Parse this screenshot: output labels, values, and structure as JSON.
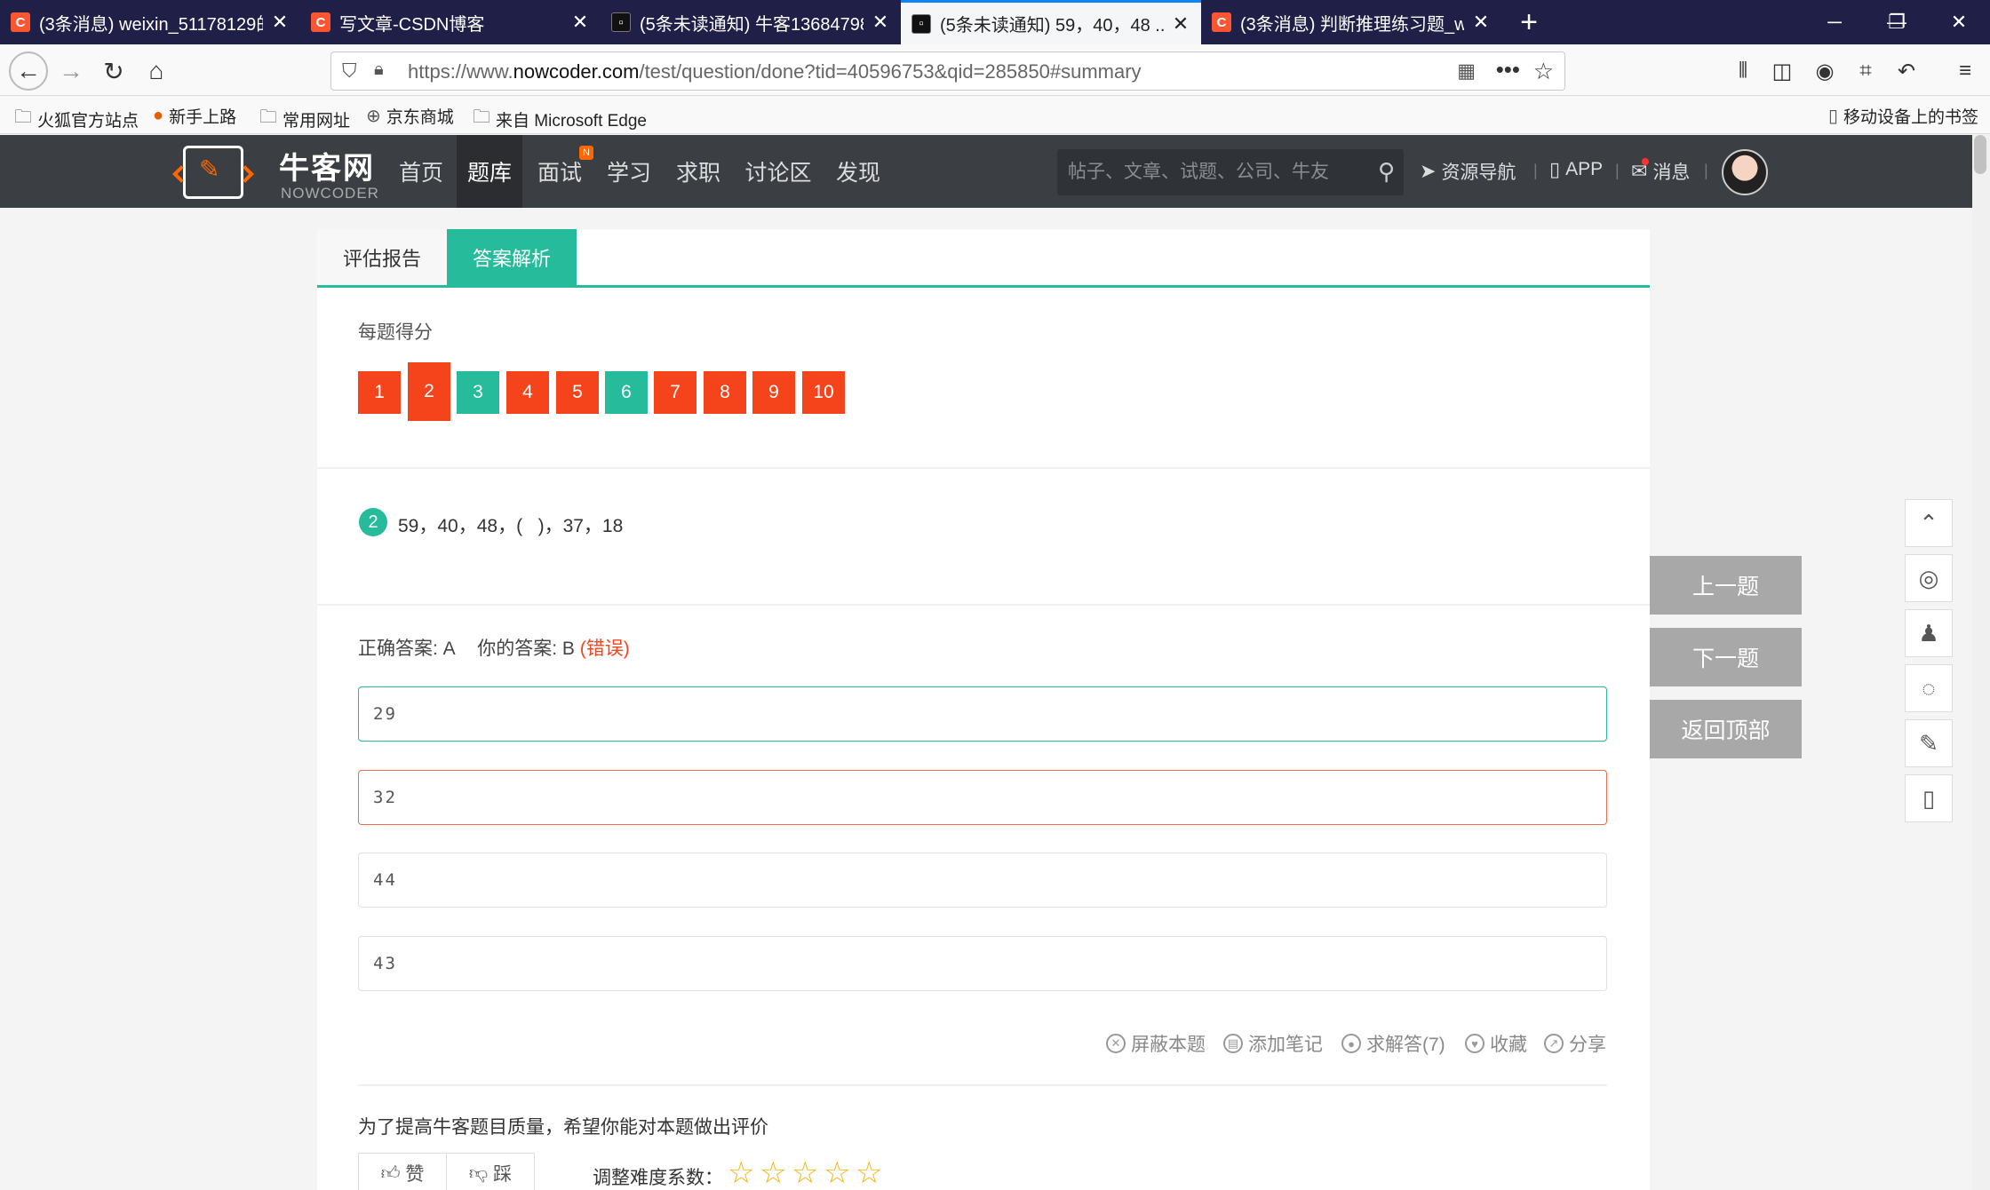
{
  "browser": {
    "tabs": [
      {
        "title": "(3条消息) weixin_51178129的",
        "icon": "csdn-icon"
      },
      {
        "title": "写文章-CSDN博客",
        "icon": "csdn-icon"
      },
      {
        "title": "(5条未读通知) 牛客136847985",
        "icon": "nowcoder-icon"
      },
      {
        "title": "(5条未读通知) 59，40，48 ..._",
        "icon": "nowcoder-icon"
      },
      {
        "title": "(3条消息) 判断推理练习题_wei",
        "icon": "csdn-icon"
      }
    ],
    "url_prefix": "https://www.",
    "url_domain": "nowcoder.com",
    "url_path": "/test/question/done?tid=40596753&qid=285850#summary",
    "bookmarks": [
      "火狐官方站点",
      "新手上路",
      "常用网址",
      "京东商城",
      "来自 Microsoft Edge"
    ],
    "mobile_bookmarks": "移动设备上的书签"
  },
  "site": {
    "logo_cn": "牛客网",
    "logo_en": "NOWCODER",
    "nav": [
      "首页",
      "题库",
      "面试",
      "学习",
      "求职",
      "讨论区",
      "发现"
    ],
    "nav_badge": "N",
    "search_placeholder": "帖子、文章、试题、公司、牛友",
    "resource_nav": "资源导航",
    "app": "APP",
    "messages": "消息"
  },
  "card": {
    "tabs": [
      "评估报告",
      "答案解析"
    ],
    "score_label": "每题得分",
    "questions": [
      {
        "num": "1",
        "status": "wrong"
      },
      {
        "num": "2",
        "status": "wrong"
      },
      {
        "num": "3",
        "status": "right"
      },
      {
        "num": "4",
        "status": "wrong"
      },
      {
        "num": "5",
        "status": "wrong"
      },
      {
        "num": "6",
        "status": "right"
      },
      {
        "num": "7",
        "status": "wrong"
      },
      {
        "num": "8",
        "status": "wrong"
      },
      {
        "num": "9",
        "status": "wrong"
      },
      {
        "num": "10",
        "status": "wrong"
      }
    ],
    "question_number": "2",
    "question_text": "59，40，48，(   )，37，18",
    "correct_label": "正确答案: A",
    "your_label": "你的答案: B",
    "wrong_mark": "(错误)",
    "options": [
      "29",
      "32",
      "44",
      "43"
    ],
    "actions": [
      "屏蔽本题",
      "添加笔记",
      "求解答(7)",
      "收藏",
      "分享"
    ],
    "rate_prompt": "为了提高牛客题目质量，希望你能对本题做出评价",
    "like": "赞",
    "dislike": "踩",
    "difficulty_label": "调整难度系数："
  },
  "side": {
    "prev": "上一题",
    "next": "下一题",
    "top": "返回顶部"
  },
  "colors": {
    "accent": "#25bb9b",
    "wrong": "#f5441c",
    "header": "#3b3e43"
  }
}
